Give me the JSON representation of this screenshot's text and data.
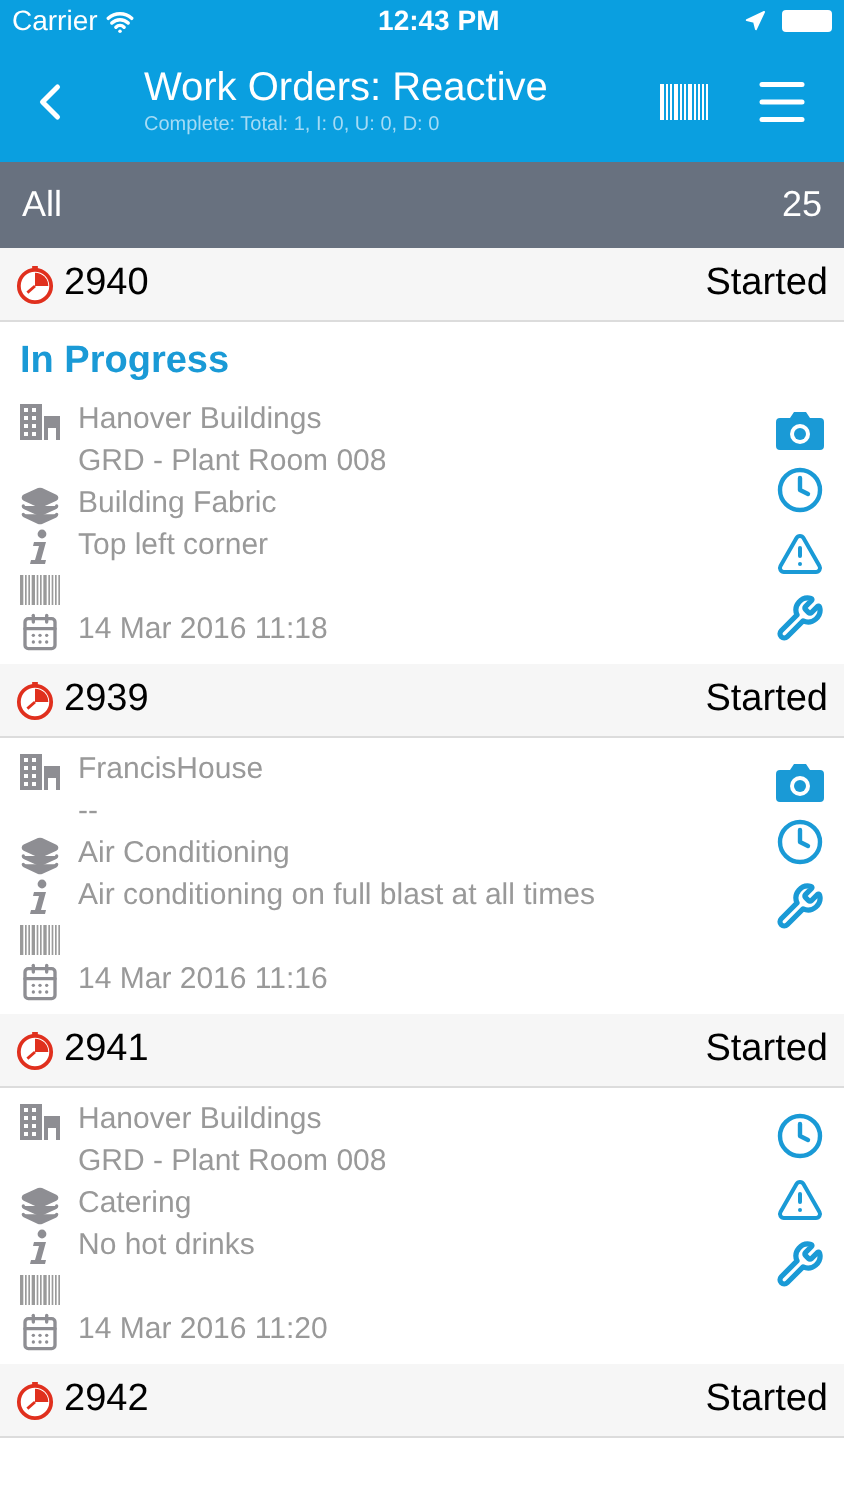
{
  "status_bar": {
    "carrier": "Carrier",
    "time": "12:43 PM"
  },
  "nav": {
    "title": "Work Orders: Reactive",
    "subtitle": "Complete: Total: 1, I: 0, U: 0, D: 0"
  },
  "filter": {
    "label": "All",
    "count": "25"
  },
  "orders": [
    {
      "number": "2940",
      "status": "Started",
      "section": "In Progress",
      "details": [
        {
          "kind": "building",
          "text": "Hanover Buildings"
        },
        {
          "kind": "sub",
          "text": "GRD - Plant Room 008"
        },
        {
          "kind": "layers",
          "text": "Building Fabric"
        },
        {
          "kind": "info",
          "text": "Top left corner"
        },
        {
          "kind": "barcode"
        },
        {
          "kind": "calendar",
          "text": "14 Mar 2016 11:18"
        }
      ],
      "actions": [
        {
          "kind": "camera"
        },
        {
          "kind": "clock"
        },
        {
          "kind": "warning"
        },
        {
          "kind": "wrench"
        }
      ]
    },
    {
      "number": "2939",
      "status": "Started",
      "details": [
        {
          "kind": "building",
          "text": "FrancisHouse"
        },
        {
          "kind": "sub",
          "text": "--"
        },
        {
          "kind": "layers",
          "text": "Air Conditioning"
        },
        {
          "kind": "info",
          "text": "Air conditioning on full blast at all times"
        },
        {
          "kind": "barcode"
        },
        {
          "kind": "calendar",
          "text": "14 Mar 2016 11:16"
        }
      ],
      "actions": [
        {
          "kind": "camera"
        },
        {
          "kind": "clock"
        },
        {
          "kind": "wrench"
        }
      ]
    },
    {
      "number": "2941",
      "status": "Started",
      "details": [
        {
          "kind": "building",
          "text": "Hanover Buildings"
        },
        {
          "kind": "sub",
          "text": "GRD - Plant Room 008"
        },
        {
          "kind": "layers",
          "text": "Catering"
        },
        {
          "kind": "info",
          "text": "No hot drinks"
        },
        {
          "kind": "barcode"
        },
        {
          "kind": "calendar",
          "text": "14 Mar 2016 11:20"
        }
      ],
      "actions": [
        {
          "kind": "clock"
        },
        {
          "kind": "warning"
        },
        {
          "kind": "wrench"
        }
      ]
    },
    {
      "number": "2942",
      "status": "Started"
    }
  ]
}
